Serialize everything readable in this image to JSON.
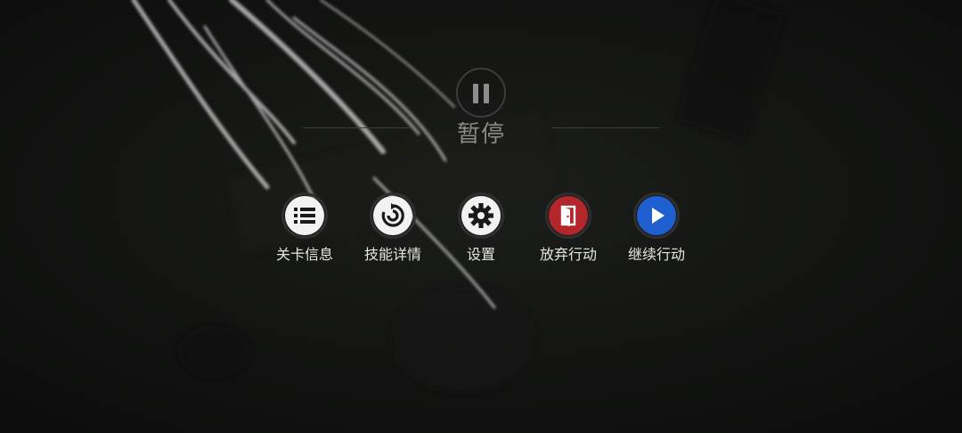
{
  "pause": {
    "title": "暂停",
    "icon": "pause-icon"
  },
  "menu": {
    "items": [
      {
        "id": "stage-info",
        "label": "关卡信息",
        "icon": "list-icon",
        "color": "#f2f2f2"
      },
      {
        "id": "skill-details",
        "label": "技能详情",
        "icon": "skill-icon",
        "color": "#f2f2f2"
      },
      {
        "id": "settings",
        "label": "设置",
        "icon": "gear-icon",
        "color": "#f2f2f2"
      },
      {
        "id": "abandon",
        "label": "放弃行动",
        "icon": "exit-door-icon",
        "color": "#b3262a"
      },
      {
        "id": "resume",
        "label": "继续行动",
        "icon": "play-icon",
        "color": "#1f5fd0"
      }
    ]
  }
}
